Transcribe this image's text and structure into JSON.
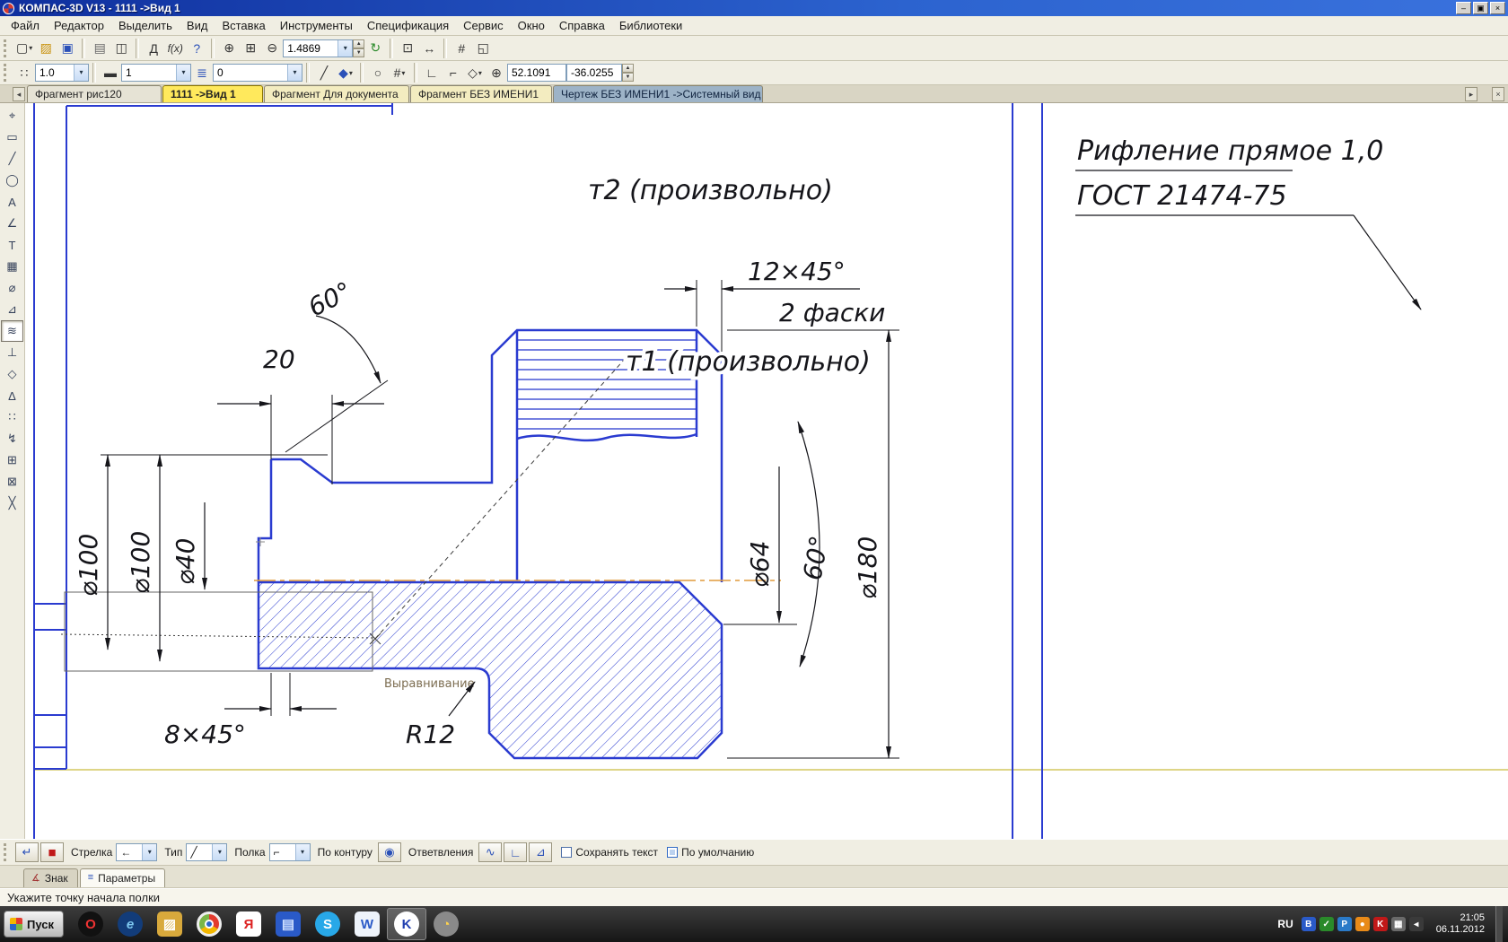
{
  "window": {
    "title": "КОМПАС-3D V13 - 1111 ->Вид 1"
  },
  "menu": {
    "items": [
      "Файл",
      "Редактор",
      "Выделить",
      "Вид",
      "Вставка",
      "Инструменты",
      "Спецификация",
      "Сервис",
      "Окно",
      "Справка",
      "Библиотеки"
    ]
  },
  "toolbar_main": {
    "zoom_value": "1.4869"
  },
  "toolbar_current": {
    "line_width": "1.0",
    "step": "1",
    "layer": "0",
    "coord_x": "52.1091",
    "coord_y": "-36.0255"
  },
  "doc_tabs": {
    "items": [
      {
        "label": "Фрагмент рис120"
      },
      {
        "label": "1111 ->Вид 1"
      },
      {
        "label": "Фрагмент Для документа"
      },
      {
        "label": "Фрагмент БЕЗ ИМЕНИ1"
      },
      {
        "label": "Чертеж БЕЗ ИМЕНИ1 ->Системный вид"
      }
    ]
  },
  "drawing": {
    "note_line1": "Рифление прямое 1,0",
    "note_line2": "ГОСТ 21474-75",
    "t2": "т2 (произвольно)",
    "t1": "т1 (произвольно)",
    "chamfer_right": "12×45°",
    "chamfer_right_note": "2 фаски",
    "angle_left": "60°",
    "len20": "20",
    "d100a": "⌀100",
    "d100b": "⌀100",
    "d40": "⌀40",
    "d64": "⌀64",
    "angle_right": "60°",
    "d180": "⌀180",
    "chamfer_left": "8×45°",
    "r12": "R12",
    "tooltip": "Выравнивание"
  },
  "property_bar": {
    "arrow": "Стрелка",
    "type": "Тип",
    "shelf": "Полка",
    "by_contour": "По контуру",
    "branches": "Ответвления",
    "keep_text": "Сохранять текст",
    "by_default": "По умолчанию"
  },
  "panel_tabs": {
    "sign": "Знак",
    "params": "Параметры"
  },
  "status": {
    "message": "Укажите точку начала полки"
  },
  "taskbar": {
    "start": "Пуск",
    "lang": "RU",
    "time": "21:05",
    "date": "06.11.2012"
  },
  "icons": {
    "minimize": "–",
    "restore": "▣",
    "close": "×",
    "new_doc": "▢",
    "open": "▨",
    "save": "▣",
    "print": "▤",
    "preview": "◫",
    "style_doc": "Д",
    "fx": "f(x)",
    "help": "?",
    "zoom_in": "⊕",
    "zoom_area": "⊞",
    "zoom_out": "⊖",
    "refresh": "↻",
    "fit": "⊡",
    "pan": "↔",
    "grid": "#",
    "windows": "◱",
    "snap_grid": "∷",
    "style_line": "▬",
    "layers": "≣",
    "pencil": "╱",
    "fill": "◆",
    "compass": "○",
    "grid2": "#",
    "ortho": "∟",
    "corner": "⌐",
    "snap": "◇",
    "axes": "⊕",
    "dropdown": "▾",
    "tab_prev": "◂",
    "tab_next": "▸",
    "tab_close": "×",
    "stop": "■",
    "create": "↵",
    "quest": "?",
    "arrow_combo": "←",
    "type_combo": "╱",
    "shelf_combo": "⌐",
    "contour_btn": "◉",
    "branch1": "∿",
    "branch2": "∟",
    "branch3": "⊿",
    "sign_tab_icon": "∡",
    "params_tab_icon": "≡",
    "left": [
      "⌖",
      "▭",
      "╱",
      "◯",
      "A",
      "∠",
      "T",
      "▦",
      "⌀",
      "⊿",
      "≋",
      "⊥",
      "◇",
      "Δ",
      "∷",
      "↯",
      "⊞",
      "⊠",
      "╳"
    ]
  }
}
